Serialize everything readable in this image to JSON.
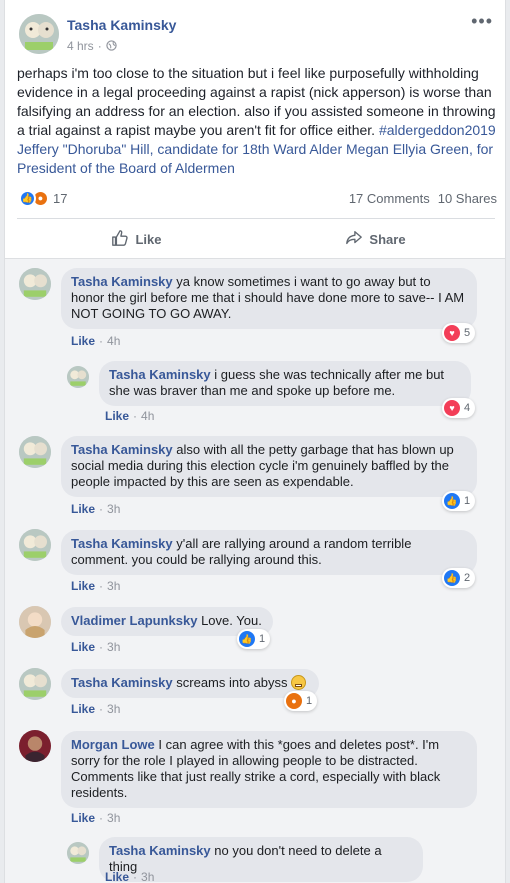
{
  "post": {
    "author": "Tasha Kaminsky",
    "time": "4 hrs",
    "body": "perhaps i'm too close to the situation but i feel like purposefully withholding evidence in a legal proceeding against a rapist (nick apperson) is worse than falsifying an address for an election. also if you assisted someone in throwing a trial against a rapist maybe you aren't fit for office either.",
    "tags": "#aldergeddon2019 Jeffery \"Dhoruba\" Hill, candidate for 18th Ward Alder Megan Ellyia Green, for President of the Board of Aldermen",
    "reaction_count": "17",
    "comments_count": "17 Comments",
    "shares_count": "10 Shares"
  },
  "actions": {
    "like": "Like",
    "share": "Share"
  },
  "comments": [
    {
      "author": "Tasha Kaminsky",
      "text": "ya know sometimes i want to go away but to honor the girl before me that i should have done more to save-- I AM NOT GOING TO GO AWAY.",
      "like": "Like",
      "time": "4h",
      "reaction": "love",
      "count": "5"
    },
    {
      "author": "Tasha Kaminsky",
      "text": "i guess she was technically after me but she was braver than me and spoke up before me.",
      "like": "Like",
      "time": "4h",
      "reaction": "love",
      "count": "4"
    },
    {
      "author": "Tasha Kaminsky",
      "text": "also with all the petty garbage that has blown up social media during this election cycle i'm genuinely baffled by the people impacted by this are seen as expendable.",
      "like": "Like",
      "time": "3h",
      "reaction": "like",
      "count": "1"
    },
    {
      "author": "Tasha Kaminsky",
      "text": "y'all are rallying around a random terrible comment. you could be rallying around this.",
      "like": "Like",
      "time": "3h",
      "reaction": "like",
      "count": "2"
    },
    {
      "author": "Vladimer Lapunksky",
      "text": "Love. You.",
      "like": "Like",
      "time": "3h",
      "reaction": "like",
      "count": "1"
    },
    {
      "author": "Tasha Kaminsky",
      "text": "screams into abyss",
      "like": "Like",
      "time": "3h",
      "reaction": "angry",
      "count": "1"
    },
    {
      "author": "Morgan Lowe",
      "text": "I can agree with this *goes and deletes post*. I'm sorry for the role I played in allowing people to be distracted. Comments like that just really strike a cord, especially with black residents.",
      "like": "Like",
      "time": "3h"
    },
    {
      "author": "Tasha Kaminsky",
      "text": "no you don't need to delete a thing",
      "like": "Like",
      "time": "3h"
    }
  ],
  "colors": {
    "link": "#385898",
    "like_blue": "#2078f4",
    "love_red": "#f33e58",
    "angry_orange": "#e9710f",
    "bubble": "#e4e6eb"
  },
  "icons": [
    "globe-icon",
    "more-icon",
    "thumbs-up-icon",
    "share-arrow-icon",
    "grimacing-emoji-icon"
  ]
}
